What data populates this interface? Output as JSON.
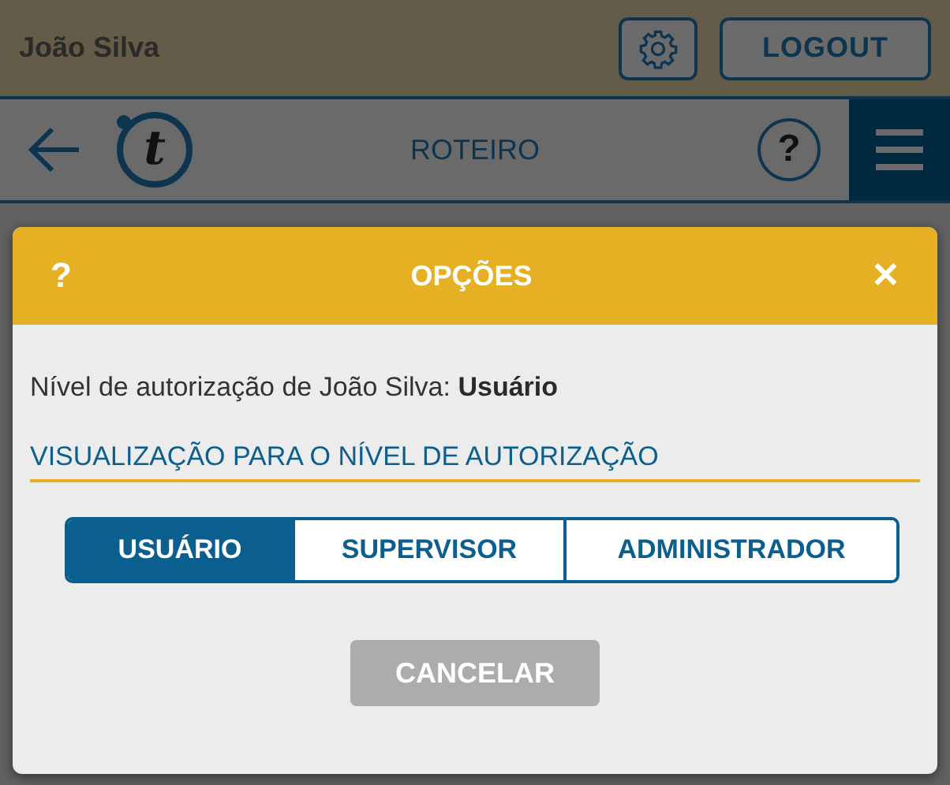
{
  "user": {
    "name": "João Silva"
  },
  "header": {
    "logout": "LOGOUT"
  },
  "nav": {
    "logo_letter": "t",
    "title": "ROTEIRO",
    "help": "?"
  },
  "dialog": {
    "help": "?",
    "title": "OPÇÕES",
    "close": "✕",
    "auth_text": "Nível de autorização de João Silva: **Usuário**",
    "section_title": "VISUALIZAÇÃO PARA O NÍVEL DE AUTORIZAÇÃO",
    "levels": [
      {
        "label": "USUÁRIO",
        "selected": true
      },
      {
        "label": "SUPERVISOR",
        "selected": false
      },
      {
        "label": "ADMINISTRADOR",
        "selected": false
      }
    ],
    "cancel": {
      "label": "CANCELAR",
      "disabled": true
    }
  }
}
